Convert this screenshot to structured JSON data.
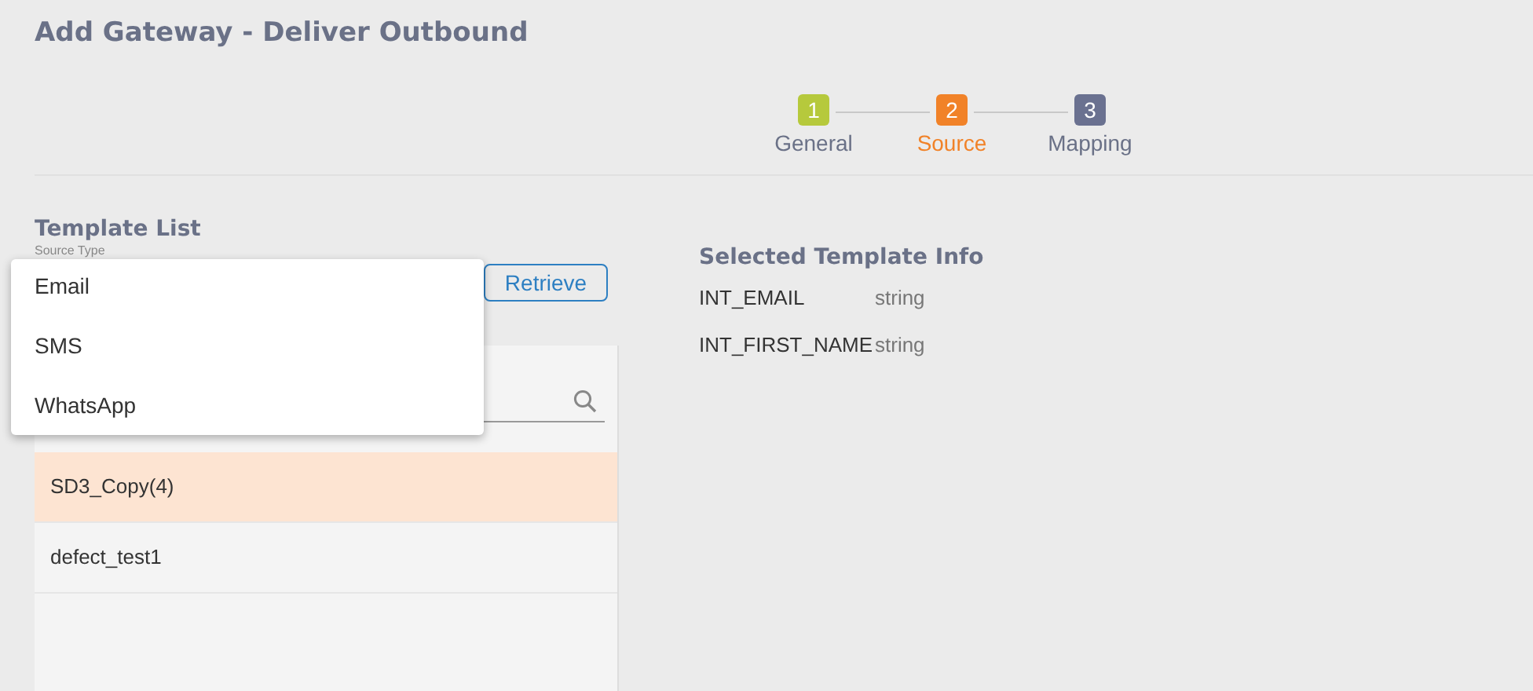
{
  "page": {
    "title": "Add Gateway - Deliver Outbound"
  },
  "steps": [
    {
      "number": "1",
      "label": "General",
      "completed": true,
      "selected": false
    },
    {
      "number": "2",
      "label": "Source",
      "completed": false,
      "selected": true
    },
    {
      "number": "3",
      "label": "Mapping",
      "completed": false,
      "selected": false
    }
  ],
  "template_list": {
    "heading": "Template List",
    "source_type_label": "Source Type",
    "retrieve_button": "Retrieve",
    "dropdown_options": [
      {
        "label": "Email"
      },
      {
        "label": "SMS"
      },
      {
        "label": "WhatsApp"
      }
    ],
    "rows": [
      {
        "name": "SD3_Copy(4)",
        "selected": true
      },
      {
        "name": "defect_test1",
        "selected": false
      }
    ]
  },
  "selected_template_info": {
    "heading": "Selected Template Info",
    "fields": [
      {
        "name": "INT_EMAIL",
        "type": "string"
      },
      {
        "name": "INT_FIRST_NAME",
        "type": "string"
      }
    ]
  }
}
